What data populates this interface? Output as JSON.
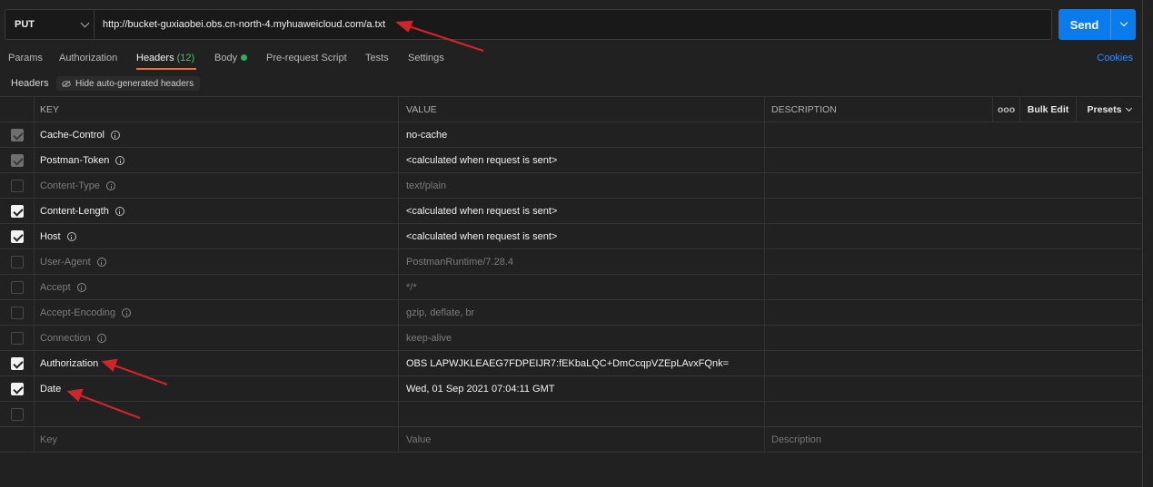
{
  "request": {
    "method": "PUT",
    "url": "http://bucket-guxiaobei.obs.cn-north-4.myhuaweicloud.com/a.txt",
    "send_label": "Send"
  },
  "tabs": {
    "params": "Params",
    "authorization": "Authorization",
    "headers": "Headers",
    "headers_count": "(12)",
    "body": "Body",
    "prerequest": "Pre-request Script",
    "tests": "Tests",
    "settings": "Settings",
    "cookies": "Cookies"
  },
  "subheader": {
    "label": "Headers",
    "hide_auto": "Hide auto-generated headers"
  },
  "table": {
    "col_key": "KEY",
    "col_value": "VALUE",
    "col_description": "DESCRIPTION",
    "more": "ooo",
    "bulk_edit": "Bulk Edit",
    "presets": "Presets",
    "rows": [
      {
        "key": "Cache-Control",
        "value": "no-cache"
      },
      {
        "key": "Postman-Token",
        "value": "<calculated when request is sent>"
      },
      {
        "key": "Content-Type",
        "value": "text/plain"
      },
      {
        "key": "Content-Length",
        "value": "<calculated when request is sent>"
      },
      {
        "key": "Host",
        "value": "<calculated when request is sent>"
      },
      {
        "key": "User-Agent",
        "value": "PostmanRuntime/7.28.4"
      },
      {
        "key": "Accept",
        "value": "*/*"
      },
      {
        "key": "Accept-Encoding",
        "value": "gzip, deflate, br"
      },
      {
        "key": "Connection",
        "value": "keep-alive"
      },
      {
        "key": "Authorization",
        "value": "OBS LAPWJKLEAEG7FDPEIJR7:fEKbaLQC+DmCcqpVZEpLAvxFQnk="
      },
      {
        "key": "Date",
        "value": "Wed, 01 Sep 2021 07:04:11 GMT"
      }
    ],
    "placeholder_key": "Key",
    "placeholder_value": "Value",
    "placeholder_description": "Description"
  },
  "colors": {
    "accent": "#097bed",
    "tab_underline": "#f26b3a",
    "annotation_arrow": "#d0242b"
  }
}
